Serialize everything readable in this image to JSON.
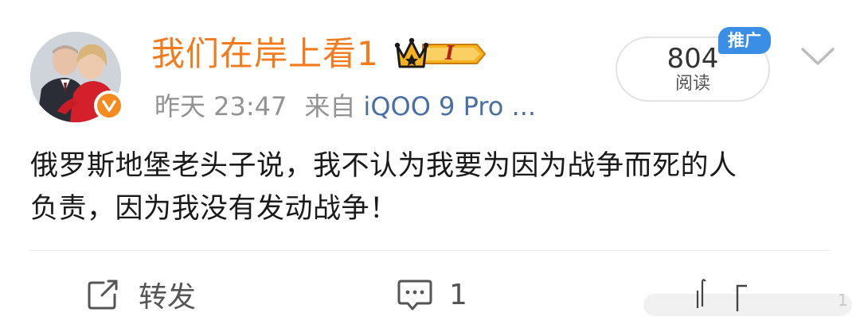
{
  "post": {
    "author": {
      "name": "我们在岸上看1",
      "avatar_icon": "user-avatar",
      "verified_badge_icon": "verified-v-icon",
      "vip_badge_icon": "crown-vip-icon",
      "vip_level": "I"
    },
    "meta": {
      "time": "昨天 23:47",
      "source_prefix": "来自",
      "device": "iQOO 9 Pro ..."
    },
    "read_count": {
      "value": "804",
      "label": "阅读"
    },
    "promo_badge": "推广",
    "content": {
      "line1": "俄罗斯地堡老头子说，我不认为我要为因为战争而死的人",
      "line2": "负责，因为我没有发动战争！"
    },
    "actions": {
      "repost_label": "转发",
      "repost_icon": "repost-icon",
      "comment_count": "1",
      "comment_icon": "comment-icon"
    },
    "overlay_number": "1"
  },
  "colors": {
    "username": "#f37b1d",
    "verified": "#f58a1f",
    "promo": "#3a8ee6",
    "meta": "#939393"
  }
}
